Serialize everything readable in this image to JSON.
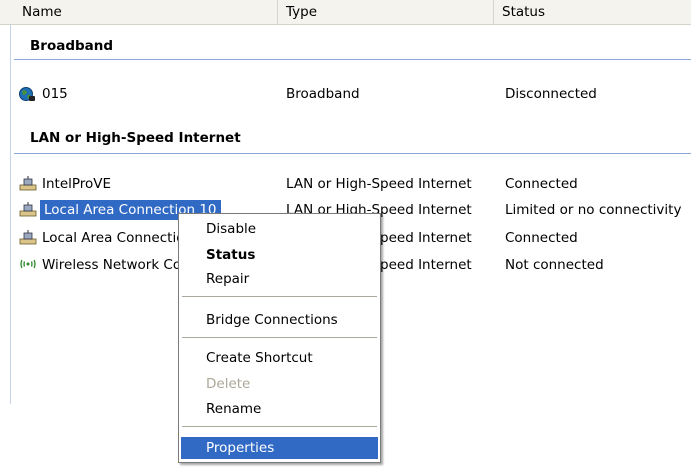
{
  "columns": {
    "name": "Name",
    "type": "Type",
    "status": "Status"
  },
  "groups": [
    {
      "title": "Broadband",
      "items": [
        {
          "name": "015",
          "type": "Broadband",
          "status": "Disconnected",
          "icon": "broadband-globe-icon"
        }
      ]
    },
    {
      "title": "LAN or High-Speed Internet",
      "items": [
        {
          "name": "IntelProVE",
          "type": "LAN or High-Speed Internet",
          "status": "Connected",
          "icon": "lan-connection-icon"
        },
        {
          "name": "Local Area Connection 10",
          "type": "LAN or High-Speed Internet",
          "status": "Limited or no connectivity",
          "icon": "lan-connection-icon"
        },
        {
          "name": "Local Area Connection",
          "type": "LAN or High-Speed Internet",
          "status": "Connected",
          "icon": "lan-connection-icon"
        },
        {
          "name": "Wireless Network Connection",
          "type": "LAN or High-Speed Internet",
          "status": "Not connected",
          "icon": "wireless-network-icon"
        }
      ]
    }
  ],
  "context_menu": {
    "disable": "Disable",
    "status": "Status",
    "repair": "Repair",
    "bridge": "Bridge Connections",
    "create_shortcut": "Create Shortcut",
    "delete": "Delete",
    "rename": "Rename",
    "properties": "Properties"
  },
  "colors": {
    "selection": "#316ac5",
    "group_line": "#8ea7d6",
    "header_bg": "#f4f3ee"
  }
}
